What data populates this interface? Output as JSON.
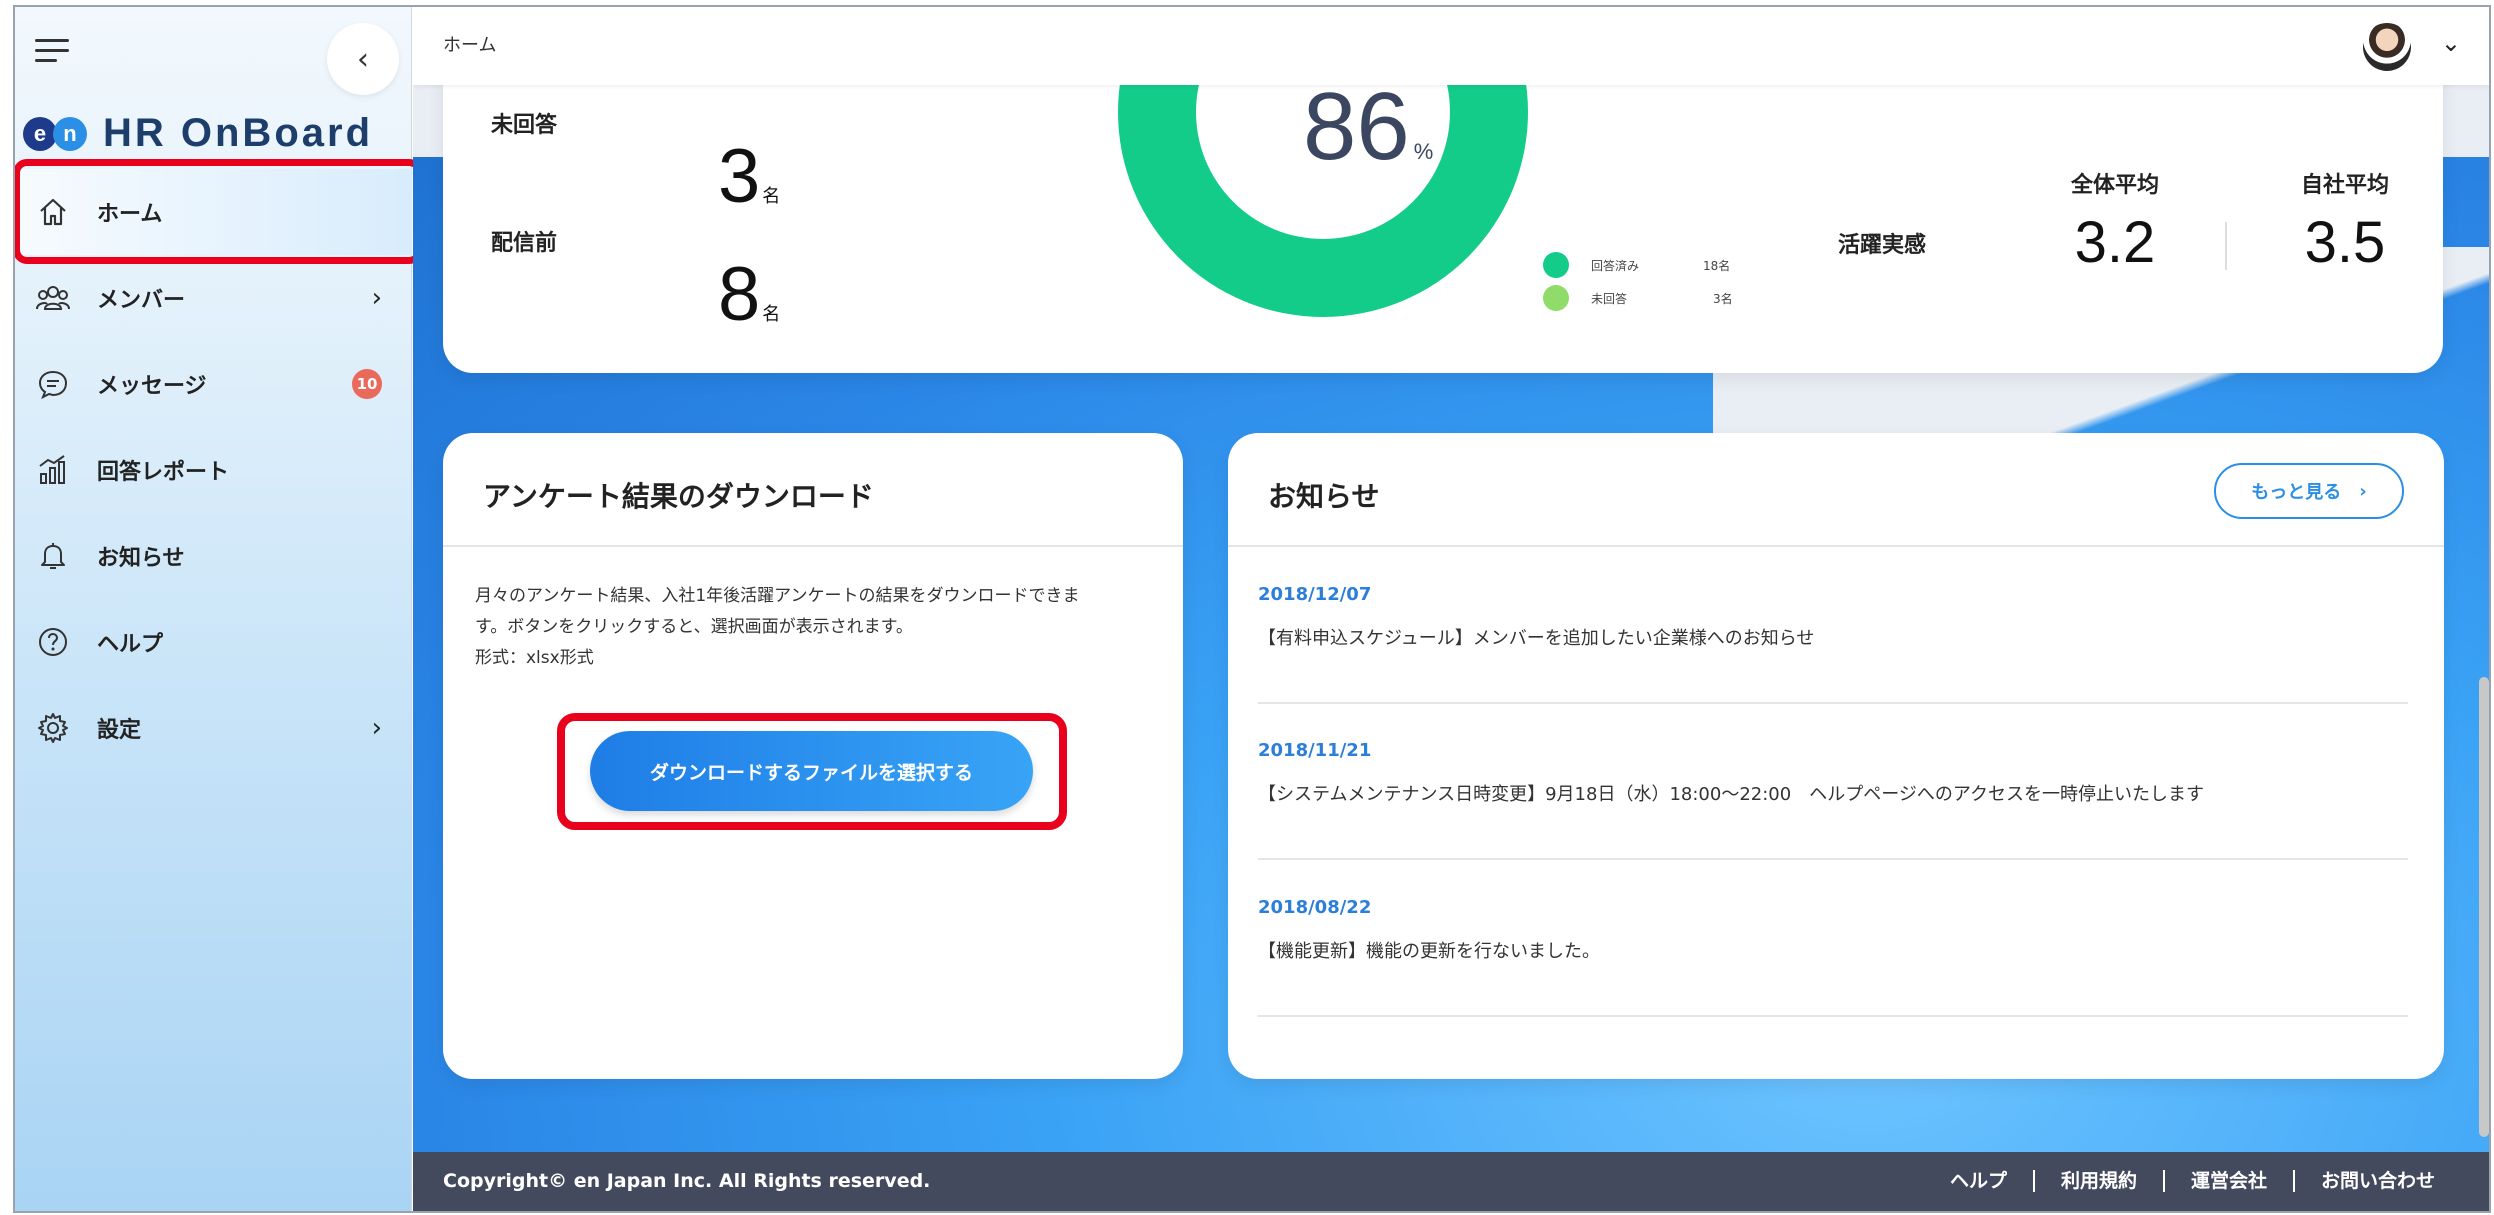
{
  "app": {
    "logo_badge_1": "e",
    "logo_badge_2": "n",
    "logo_text": "HR OnBoard"
  },
  "sidebar": {
    "collapse_glyph": "‹",
    "items": [
      {
        "label": "ホーム",
        "icon": "home-icon",
        "active": true
      },
      {
        "label": "メンバー",
        "icon": "members-icon",
        "chevron": "›"
      },
      {
        "label": "メッセージ",
        "icon": "message-icon",
        "badge": "10"
      },
      {
        "label": "回答レポート",
        "icon": "report-chart-icon"
      },
      {
        "label": "お知らせ",
        "icon": "bell-icon"
      },
      {
        "label": "ヘルプ",
        "icon": "help-icon"
      },
      {
        "label": "設定",
        "icon": "gear-icon",
        "chevron": "›"
      }
    ]
  },
  "header": {
    "breadcrumb": "ホーム",
    "user_menu_glyph": "⌄"
  },
  "summary": {
    "unanswered_label": "未回答",
    "unanswered_value": "3",
    "before_delivery_label": "配信前",
    "before_delivery_value": "8",
    "unit": "名",
    "response_rate_value": "86",
    "response_rate_unit": "%",
    "legend": [
      {
        "label": "回答済み",
        "value": "18名",
        "color": "#13cc8a"
      },
      {
        "label": "未回答",
        "value": "3名",
        "color": "#8fdc6a"
      }
    ],
    "katsuyaku_label": "活躍実感",
    "overall_avg_label": "全体平均",
    "overall_avg_value": "3.2",
    "company_avg_label": "自社平均",
    "company_avg_value": "3.5"
  },
  "download": {
    "title": "アンケート結果のダウンロード",
    "description_line1": "月々のアンケート結果、入社1年後活躍アンケートの結果をダウンロードできま",
    "description_line2": "す。ボタンをクリックすると、選択画面が表示されます。",
    "description_line3": "形式：xlsx形式",
    "button_label": "ダウンロードするファイルを選択する"
  },
  "news": {
    "title": "お知らせ",
    "more_label": "もっと見る",
    "more_arrow": "›",
    "items": [
      {
        "date": "2018/12/07",
        "text": "【有料申込スケジュール】メンバーを追加したい企業様へのお知らせ"
      },
      {
        "date": "2018/11/21",
        "text": "【システムメンテナンス日時変更】9月18日（水）18:00～22:00　ヘルプページへのアクセスを一時停止いたします"
      },
      {
        "date": "2018/08/22",
        "text": "【機能更新】機能の更新を行ないました。"
      }
    ]
  },
  "footer": {
    "copyright": "Copyright© en Japan Inc. All Rights reserved.",
    "links": [
      "ヘルプ",
      "利用規約",
      "運営会社",
      "お問い合わせ"
    ]
  },
  "colors": {
    "accent": "#2b8fe6",
    "donut_answered": "#13cc8a",
    "donut_unanswered": "#8fdc6a",
    "highlight": "#e8001c",
    "badge": "#e9695b",
    "footer_bg": "#434a5d"
  }
}
